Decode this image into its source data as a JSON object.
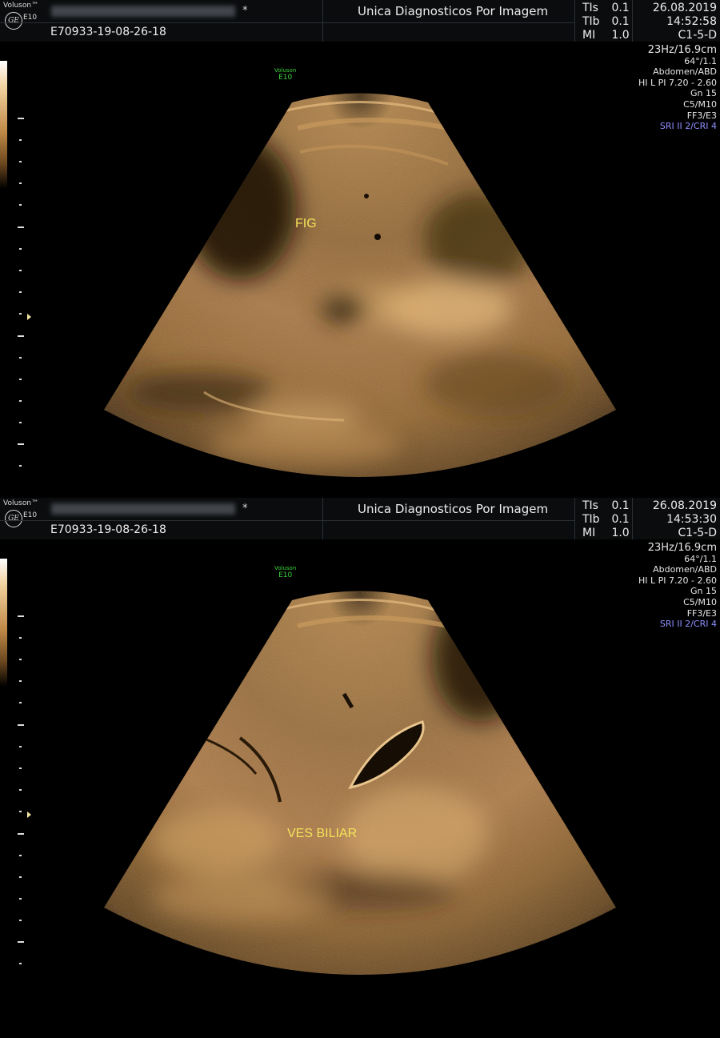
{
  "panels": [
    {
      "brand": "Voluson™",
      "model": "E10",
      "star": "*",
      "institution": "Unica Diagnosticos Por Imagem",
      "patient_id": "E70933-19-08-26-18",
      "tis_label": "TIs",
      "tis_value": "0.1",
      "tib_label": "TIb",
      "tib_value": "0.1",
      "mi_label": "MI",
      "mi_value": "1.0",
      "date": "26.08.2019",
      "time": "14:52:58",
      "probe": "C1-5-D",
      "params": [
        "23Hz/16.9cm",
        "64°/1.1",
        "Abdomen/ABD",
        "HI L PI 7.20 - 2.60",
        "Gn 15",
        "C5/M10",
        "FF3/E3",
        "SRI II 2/CRI 4"
      ],
      "overlay_brand": "Voluson",
      "overlay_model": "E10",
      "annotation": "FIG"
    },
    {
      "brand": "Voluson™",
      "model": "E10",
      "star": "*",
      "institution": "Unica Diagnosticos Por Imagem",
      "patient_id": "E70933-19-08-26-18",
      "tis_label": "TIs",
      "tis_value": "0.1",
      "tib_label": "TIb",
      "tib_value": "0.1",
      "mi_label": "MI",
      "mi_value": "1.0",
      "date": "26.08.2019",
      "time": "14:53:30",
      "probe": "C1-5-D",
      "params": [
        "23Hz/16.9cm",
        "64°/1.1",
        "Abdomen/ABD",
        "HI L PI 7.20 - 2.60",
        "Gn 15",
        "C5/M10",
        "FF3/E3",
        "SRI II 2/CRI 4"
      ],
      "overlay_brand": "Voluson",
      "overlay_model": "E10",
      "annotation": "VES BILIAR"
    }
  ],
  "colors": {
    "tissue": "#a87a45",
    "annotation": "#f3e35a",
    "param_highlight": "#8f8fff",
    "overlay_logo": "#3bd23b"
  }
}
